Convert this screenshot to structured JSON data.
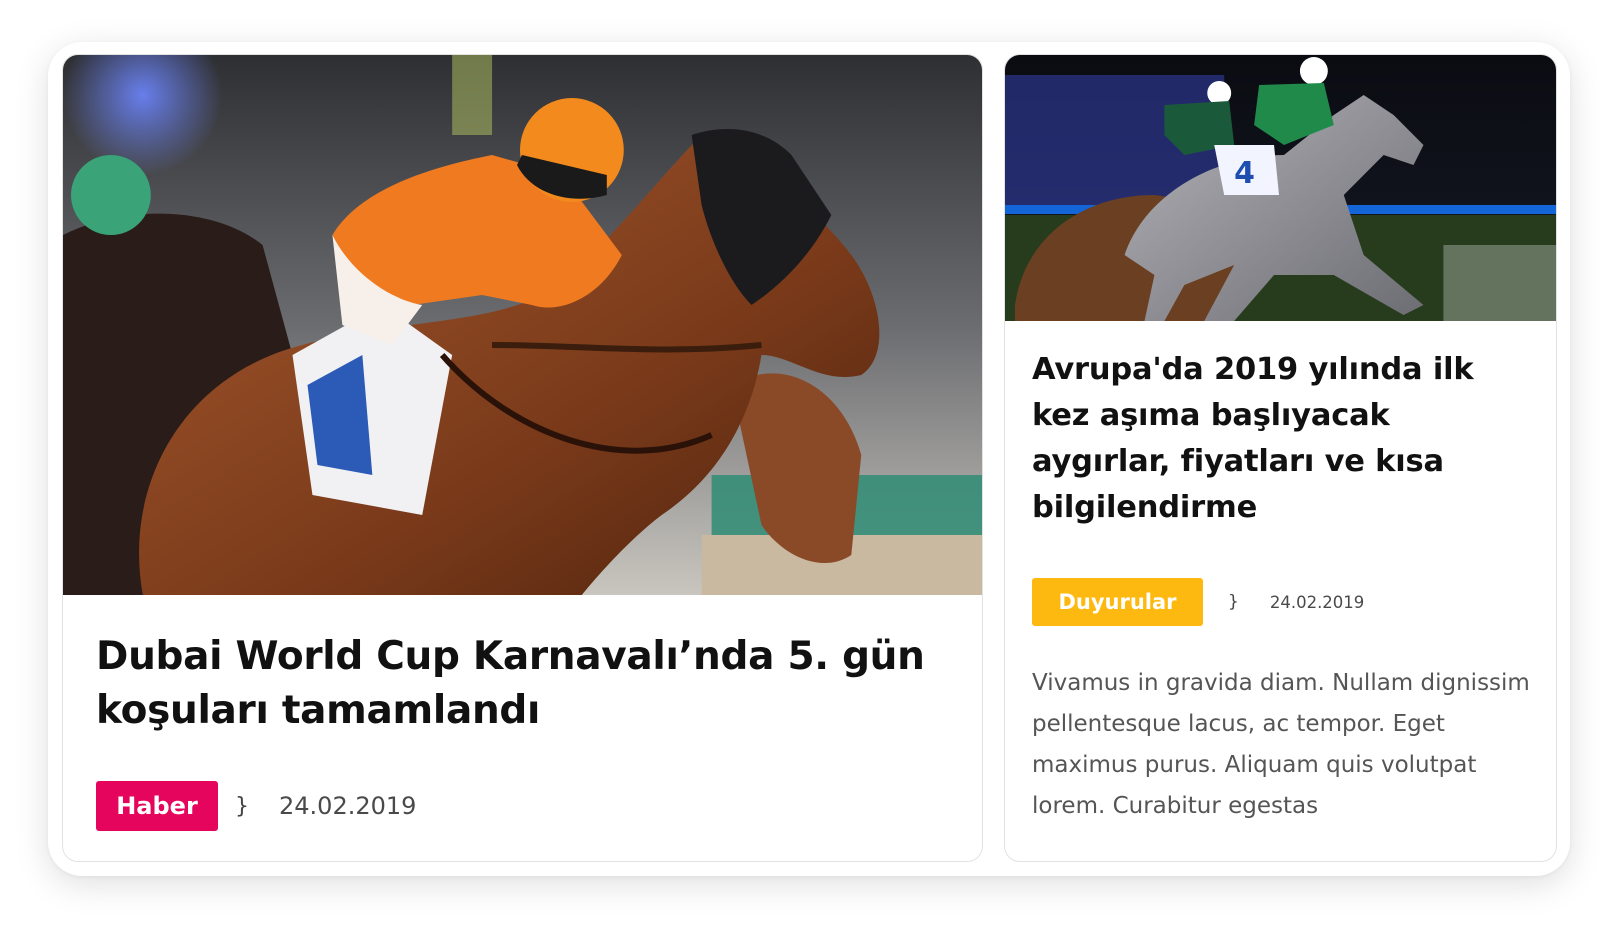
{
  "cards": [
    {
      "image_alt": "Jockey in orange silks riding a chestnut horse",
      "title": "Dubai World Cup Karnavalı’nda 5. gün koşuları tamamlandı",
      "category": "Haber",
      "separator": "}",
      "date": "24.02.2019",
      "category_color": "#e6055c"
    },
    {
      "image_alt": "Jockeys in green silks racing grey horses at night",
      "title": "Avrupa'da 2019 yılında ilk kez aşıma başlıyacak aygırlar, fiyatları ve kısa bilgilendirme",
      "category": "Duyurular",
      "separator": "}",
      "date": "24.02.2019",
      "excerpt": "Vivamus in gravida diam. Nullam dignissim pellentesque lacus, ac tempor. Eget maximus purus. Aliquam quis volutpat lorem. Curabitur egestas",
      "category_color": "#fdb90f"
    }
  ]
}
